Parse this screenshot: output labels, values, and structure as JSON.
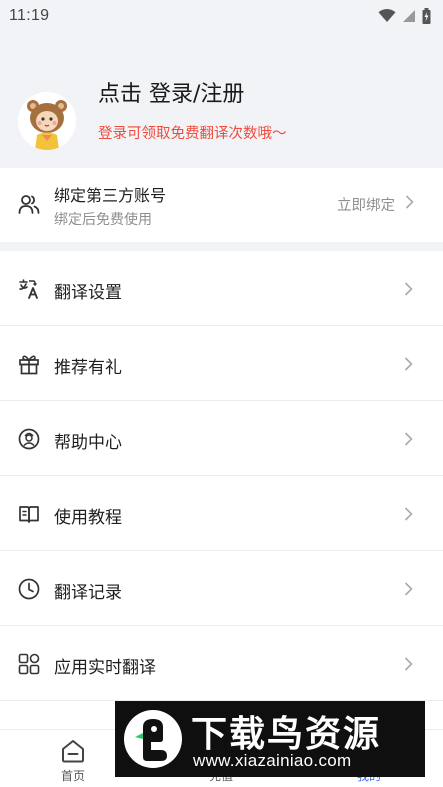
{
  "status_bar": {
    "time": "11:19"
  },
  "profile": {
    "login_title": "点击 登录/注册",
    "login_subtitle": "登录可领取免费翻译次数哦～"
  },
  "bind": {
    "title": "绑定第三方账号",
    "subtitle": "绑定后免费使用",
    "action": "立即绑定"
  },
  "menu": {
    "items": [
      {
        "label": "翻译设置",
        "icon": "translate-icon"
      },
      {
        "label": "推荐有礼",
        "icon": "gift-icon"
      },
      {
        "label": "帮助中心",
        "icon": "support-icon"
      },
      {
        "label": "使用教程",
        "icon": "book-icon"
      },
      {
        "label": "翻译记录",
        "icon": "clock-icon"
      },
      {
        "label": "应用实时翻译",
        "icon": "apps-grid-icon"
      }
    ]
  },
  "tabbar": {
    "tabs": [
      {
        "label": "首页",
        "icon": "home-icon"
      },
      {
        "label": "充值",
        "icon": "recharge-icon"
      },
      {
        "label": "我的",
        "icon": "profile-icon",
        "active": true
      }
    ]
  },
  "watermark": {
    "title": "下载鸟资源",
    "url": "www.xiazainiao.com"
  },
  "colors": {
    "accent_red": "#ef4b3c",
    "active_tab": "#3a6df0",
    "background": "#f2f3f7"
  }
}
